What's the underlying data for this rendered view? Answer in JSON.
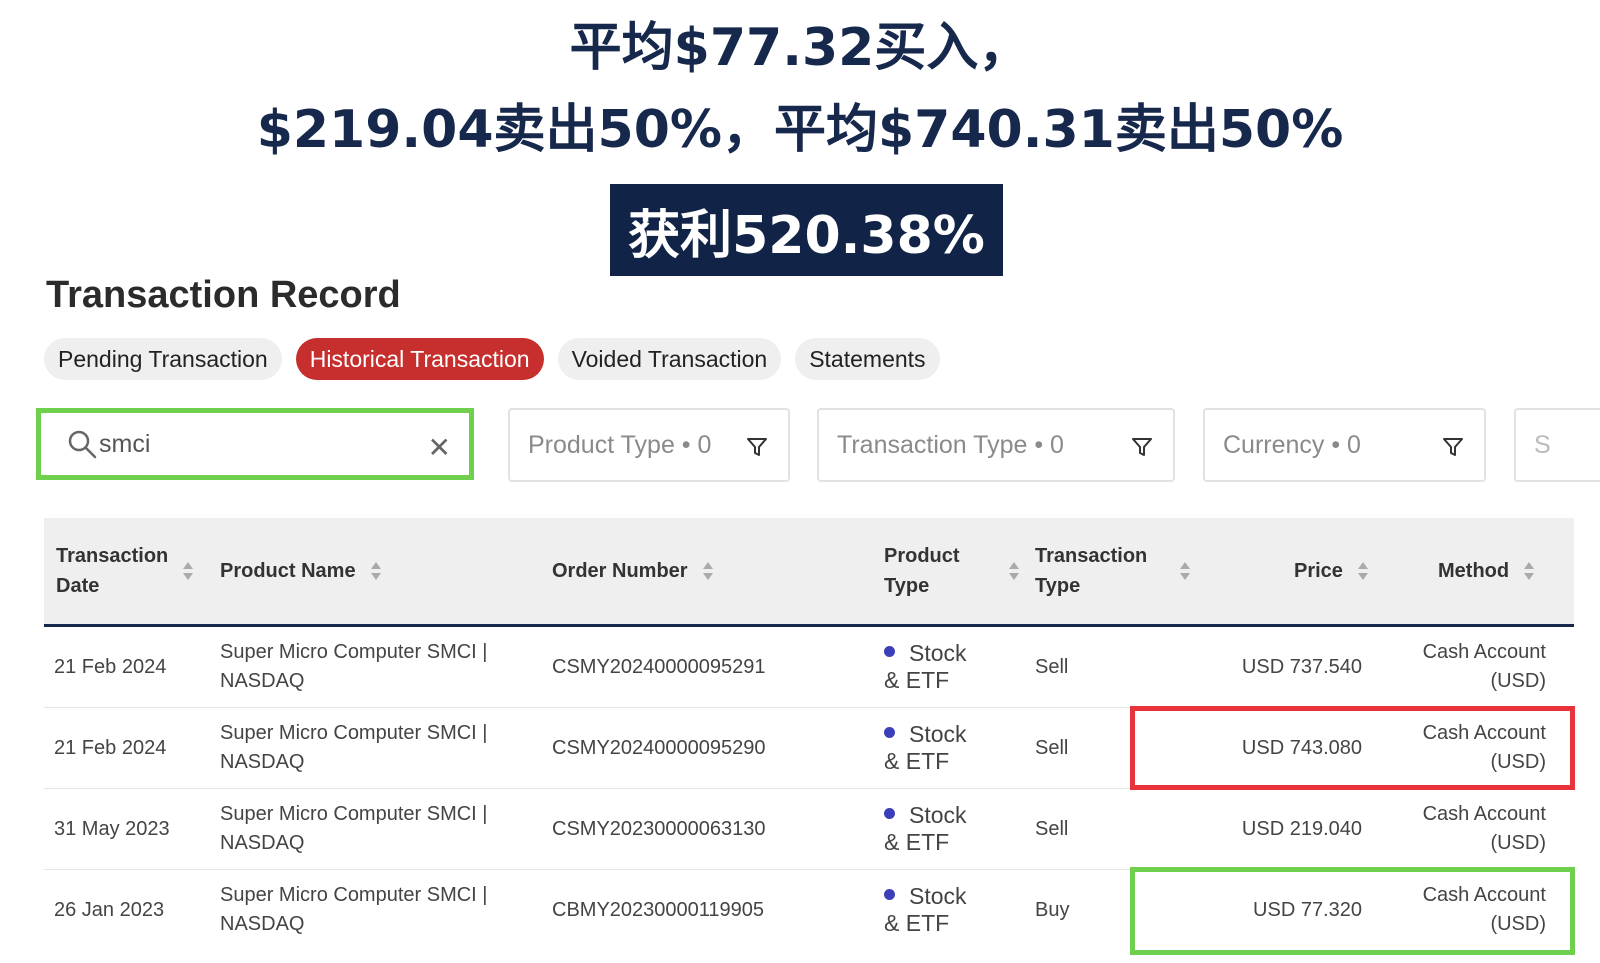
{
  "headline": {
    "line1": "平均$77.32买入，",
    "line2": "$219.04卖出50%，平均$740.31卖出50%",
    "profit": "获利520.38%"
  },
  "page_title": "Transaction Record",
  "tabs": [
    {
      "label": "Pending Transaction",
      "active": false
    },
    {
      "label": "Historical Transaction",
      "active": true
    },
    {
      "label": "Voided Transaction",
      "active": false
    },
    {
      "label": "Statements",
      "active": false
    }
  ],
  "search": {
    "value": "smci"
  },
  "filters": {
    "product_type": "Product Type • 0",
    "transaction_type": "Transaction Type • 0",
    "currency": "Currency • 0",
    "more": "S"
  },
  "table": {
    "headers": {
      "date_l1": "Transaction",
      "date_l2": "Date",
      "product": "Product Name",
      "order": "Order Number",
      "ptype_l1": "Product",
      "ptype_l2": "Type",
      "ttype_l1": "Transaction",
      "ttype_l2": "Type",
      "price": "Price",
      "method": "Method"
    },
    "rows": [
      {
        "date": "21 Feb 2024",
        "product_l1": "Super Micro Computer SMCI |",
        "product_l2": "NASDAQ",
        "order": "CSMY20240000095291",
        "ptype_l1": "Stock",
        "ptype_l2": "& ETF",
        "ttype": "Sell",
        "price": "USD 737.540",
        "method_l1": "Cash Account",
        "method_l2": "(USD)"
      },
      {
        "date": "21 Feb 2024",
        "product_l1": "Super Micro Computer SMCI |",
        "product_l2": "NASDAQ",
        "order": "CSMY20240000095290",
        "ptype_l1": "Stock",
        "ptype_l2": "& ETF",
        "ttype": "Sell",
        "price": "USD 743.080",
        "method_l1": "Cash Account",
        "method_l2": "(USD)"
      },
      {
        "date": "31 May 2023",
        "product_l1": "Super Micro Computer SMCI |",
        "product_l2": "NASDAQ",
        "order": "CSMY20230000063130",
        "ptype_l1": "Stock",
        "ptype_l2": "& ETF",
        "ttype": "Sell",
        "price": "USD 219.040",
        "method_l1": "Cash Account",
        "method_l2": "(USD)"
      },
      {
        "date": "26 Jan 2023",
        "product_l1": "Super Micro Computer SMCI |",
        "product_l2": "NASDAQ",
        "order": "CBMY20230000119905",
        "ptype_l1": "Stock",
        "ptype_l2": "& ETF",
        "ttype": "Buy",
        "price": "USD 77.320",
        "method_l1": "Cash Account",
        "method_l2": "(USD)"
      }
    ]
  },
  "colors": {
    "headline": "#17284d",
    "active_tab": "#c62f2d",
    "highlight_green": "#6fd04d",
    "highlight_red": "#e8333a",
    "dot": "#3b3fb8"
  },
  "icons": [
    "search-icon",
    "close-icon",
    "filter-funnel-icon",
    "sort-icon",
    "bullet-dot-icon"
  ]
}
